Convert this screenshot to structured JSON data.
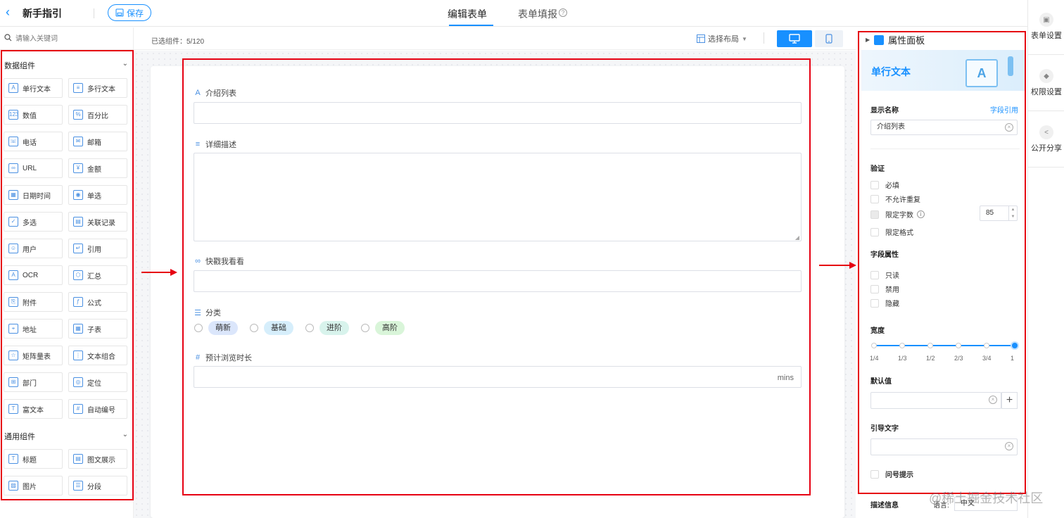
{
  "topbar": {
    "title": "新手指引",
    "save_label": "保存",
    "tabs": [
      {
        "label": "编辑表单",
        "active": true
      },
      {
        "label": "表单填报",
        "active": false
      }
    ]
  },
  "right_strip": {
    "items": [
      {
        "label": "表单设置",
        "icon": "form-settings-icon"
      },
      {
        "label": "权限设置",
        "icon": "shield-icon"
      },
      {
        "label": "公开分享",
        "icon": "share-icon"
      }
    ]
  },
  "left_panel": {
    "search_placeholder": "请输入关键词",
    "groups": [
      {
        "title": "数据组件",
        "items": [
          {
            "label": "单行文本",
            "icon": "A"
          },
          {
            "label": "多行文本",
            "icon": "≡"
          },
          {
            "label": "数值",
            "icon": "123"
          },
          {
            "label": "百分比",
            "icon": "%"
          },
          {
            "label": "电话",
            "icon": "☏"
          },
          {
            "label": "邮箱",
            "icon": "✉"
          },
          {
            "label": "URL",
            "icon": "∞"
          },
          {
            "label": "金额",
            "icon": "¥"
          },
          {
            "label": "日期时间",
            "icon": "▦"
          },
          {
            "label": "单选",
            "icon": "◉"
          },
          {
            "label": "多选",
            "icon": "✓"
          },
          {
            "label": "关联记录",
            "icon": "▤"
          },
          {
            "label": "用户",
            "icon": "☺"
          },
          {
            "label": "引用",
            "icon": "↵"
          },
          {
            "label": "OCR",
            "icon": "A"
          },
          {
            "label": "汇总",
            "icon": "⬡"
          },
          {
            "label": "附件",
            "icon": "⎘"
          },
          {
            "label": "公式",
            "icon": "ƒ"
          },
          {
            "label": "地址",
            "icon": "⌖"
          },
          {
            "label": "子表",
            "icon": "▦"
          },
          {
            "label": "矩阵量表",
            "icon": "☆"
          },
          {
            "label": "文本组合",
            "icon": "⋮"
          },
          {
            "label": "部门",
            "icon": "⊞"
          },
          {
            "label": "定位",
            "icon": "◎"
          },
          {
            "label": "富文本",
            "icon": "T"
          },
          {
            "label": "自动编号",
            "icon": "#"
          }
        ]
      },
      {
        "title": "通用组件",
        "items": [
          {
            "label": "标题",
            "icon": "T"
          },
          {
            "label": "图文展示",
            "icon": "▤"
          },
          {
            "label": "图片",
            "icon": "▨"
          },
          {
            "label": "分段",
            "icon": "☰"
          }
        ]
      }
    ]
  },
  "center": {
    "selected_count": "已选组件：5/120",
    "layout_label": "选择布局",
    "fields": [
      {
        "label": "介绍列表",
        "icon": "A",
        "kind": "input"
      },
      {
        "label": "详细描述",
        "icon": "≡",
        "kind": "textarea"
      },
      {
        "label": "快戳我看看",
        "icon": "∞",
        "kind": "input"
      },
      {
        "label": "分类",
        "icon": "☰",
        "kind": "radio"
      },
      {
        "label": "预计浏览时长",
        "icon": "#",
        "kind": "number",
        "unit": "mins"
      }
    ],
    "radio_options": [
      {
        "label": "萌新",
        "color": "#dbe6fb"
      },
      {
        "label": "基础",
        "color": "#d6eefb"
      },
      {
        "label": "进阶",
        "color": "#d8f3ec"
      },
      {
        "label": "高阶",
        "color": "#d9f5d9"
      }
    ]
  },
  "property_panel": {
    "header": "属性面板",
    "component_title": "单行文本",
    "display_name_label": "显示名称",
    "field_ref_link": "字段引用",
    "display_name_value": "介绍列表",
    "validation_label": "验证",
    "validation_options": [
      {
        "label": "必填",
        "checked": false
      },
      {
        "label": "不允许重复",
        "checked": false
      },
      {
        "label": "限定字数",
        "checked": true
      },
      {
        "label": "限定格式",
        "checked": false
      }
    ],
    "char_limit": "85",
    "field_props_label": "字段属性",
    "field_props": [
      {
        "label": "只读"
      },
      {
        "label": "禁用"
      },
      {
        "label": "隐藏"
      }
    ],
    "width_label": "宽度",
    "width_ticks": [
      "1/4",
      "1/3",
      "1/2",
      "2/3",
      "3/4",
      "1"
    ],
    "width_value": "1",
    "default_label": "默认值",
    "guide_label": "引导文字",
    "tooltip_label": "问号提示",
    "desc_label": "描述信息",
    "lang_label": "语言:",
    "lang_value": "中文"
  },
  "watermark": "@稀土掘金技术社区",
  "colors": {
    "accent": "#1890ff",
    "annotation_red": "#e60012"
  }
}
